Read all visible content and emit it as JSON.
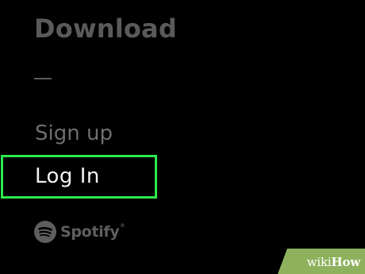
{
  "menu": {
    "download_label": "Download",
    "signup_label": "Sign up",
    "login_label": "Log In"
  },
  "brand": {
    "icon": "spotify-icon",
    "wordmark": "Spotify",
    "trademark": "®"
  },
  "highlight": {
    "color": "#2ee84a"
  },
  "watermark": {
    "part1": "wiki",
    "part2": "How"
  }
}
